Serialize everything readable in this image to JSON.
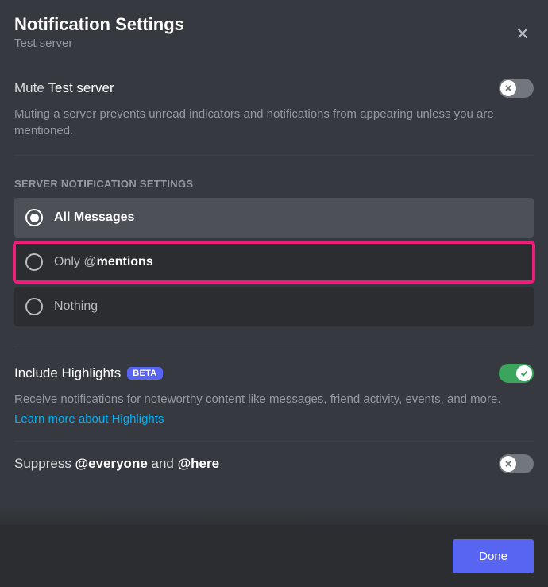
{
  "header": {
    "title": "Notification Settings",
    "subtitle": "Test server"
  },
  "mute": {
    "label_prefix": "Mute ",
    "server_name": "Test server",
    "description": "Muting a server prevents unread indicators and notifications from appearing unless you are mentioned.",
    "enabled": false
  },
  "server_notifications": {
    "header": "SERVER NOTIFICATION SETTINGS",
    "options": [
      {
        "label": "All Messages",
        "selected": true
      },
      {
        "label_prefix": "Only ",
        "label_at": "@",
        "label_bold": "mentions",
        "selected": false,
        "highlighted": true
      },
      {
        "label": "Nothing",
        "selected": false
      }
    ]
  },
  "highlights": {
    "label": "Include Highlights",
    "badge": "BETA",
    "description": "Receive notifications for noteworthy content like messages, friend activity, events, and more.",
    "link": "Learn more about Highlights",
    "enabled": true
  },
  "suppress": {
    "label_prefix": "Suppress ",
    "everyone": "@everyone",
    "and": " and ",
    "here": "@here",
    "enabled": false
  },
  "footer": {
    "done": "Done"
  }
}
